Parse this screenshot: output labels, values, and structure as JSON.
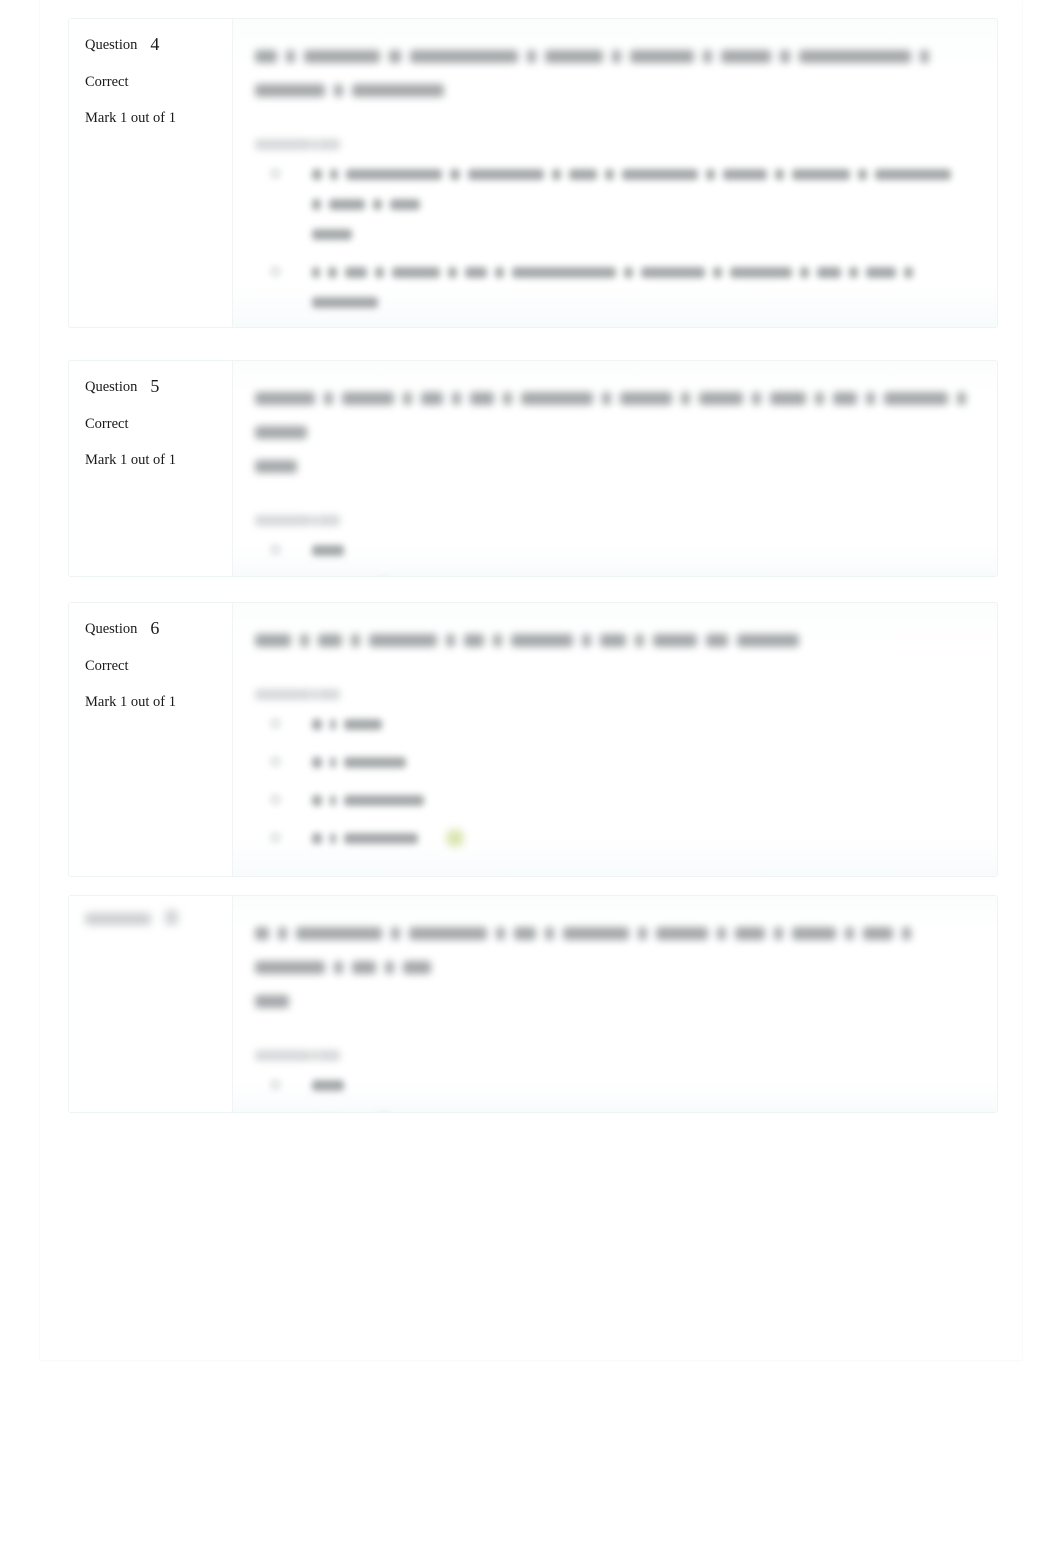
{
  "page": {
    "type": "quiz-review",
    "background": "#ffffff",
    "container_border": "#eef3f4",
    "accent_correct": "#c8d98a"
  },
  "labels": {
    "question_word": "Question",
    "state_correct": "Correct",
    "mark_text": "Mark 1 out of 1",
    "answer_choose_label": "Select one:"
  },
  "questions": [
    {
      "number": "4",
      "state": "Correct",
      "mark": "Mark 1 out of 1",
      "info_blurred": false,
      "stem_redacted": true,
      "stem_lines": [
        [
          22,
          9,
          76,
          12,
          108,
          9,
          58,
          9,
          64,
          9,
          50,
          10,
          112,
          9,
          70,
          9,
          92
        ]
      ],
      "prompt_redacted": true,
      "options": [
        {
          "lines": [
            [
              10,
              8,
              96,
              10,
              76,
              9,
              28,
              9,
              76,
              9,
              44,
              9,
              58,
              9,
              76,
              9,
              36,
              9,
              30
            ],
            [
              40
            ]
          ],
          "correct_marker": false
        },
        {
          "lines": [
            [
              8,
              9,
              22,
              9,
              48,
              9,
              22,
              9,
              104,
              9,
              64,
              9,
              62,
              9,
              24,
              9,
              30,
              9,
              66
            ]
          ],
          "correct_marker": false
        },
        {
          "lines": [
            [
              10,
              9,
              92,
              9,
              78,
              9,
              26,
              9,
              44,
              9,
              32,
              9,
              40,
              9,
              52,
              9,
              40,
              9,
              14
            ],
            [
              60
            ]
          ],
          "correct_marker": false
        },
        {
          "lines": [
            [
              10,
              9,
              88,
              9,
              78,
              9,
              24,
              9,
              38,
              9,
              76
            ]
          ],
          "correct_marker": true
        }
      ]
    },
    {
      "number": "5",
      "state": "Correct",
      "mark": "Mark 1 out of 1",
      "info_blurred": false,
      "stem_redacted": true,
      "stem_lines": [
        [
          60,
          9,
          52,
          9,
          22,
          9,
          24,
          9,
          72,
          9,
          52,
          9,
          44,
          9,
          36,
          9,
          24,
          9,
          64,
          9,
          52
        ],
        [
          42
        ]
      ],
      "prompt_redacted": true,
      "options": [
        {
          "lines": [
            [
              32
            ]
          ],
          "correct_marker": false
        },
        {
          "lines": [
            [
              34
            ]
          ],
          "correct_marker": true
        }
      ]
    },
    {
      "number": "6",
      "state": "Correct",
      "mark": "Mark 1 out of 1",
      "info_blurred": false,
      "info_clipped": true,
      "stem_redacted": true,
      "stem_lines": [
        [
          36,
          9,
          24,
          9,
          68,
          9,
          20,
          9,
          62,
          9,
          26,
          9,
          44,
          22,
          62
        ]
      ],
      "prompt_redacted": true,
      "options": [
        {
          "lines": [
            [
              10,
              6,
              38
            ]
          ],
          "correct_marker": false
        },
        {
          "lines": [
            [
              10,
              6,
              62
            ]
          ],
          "correct_marker": false
        },
        {
          "lines": [
            [
              10,
              6,
              80
            ]
          ],
          "correct_marker": false
        },
        {
          "lines": [
            [
              10,
              6,
              74
            ]
          ],
          "correct_marker": true
        }
      ]
    },
    {
      "number": "",
      "state": "",
      "mark": "",
      "info_blurred": true,
      "info_bar_widths": [
        66,
        44,
        88
      ],
      "stem_redacted": true,
      "stem_lines": [
        [
          14,
          9,
          86,
          9,
          78,
          9,
          22,
          9,
          66,
          9,
          52,
          9,
          30,
          9,
          44,
          9,
          30,
          9,
          70,
          9,
          24,
          9,
          28
        ],
        [
          34
        ]
      ],
      "prompt_redacted": true,
      "options": [
        {
          "lines": [
            [
              32
            ]
          ],
          "correct_marker": false
        },
        {
          "lines": [
            [
              34
            ]
          ],
          "correct_marker": true
        }
      ]
    }
  ]
}
